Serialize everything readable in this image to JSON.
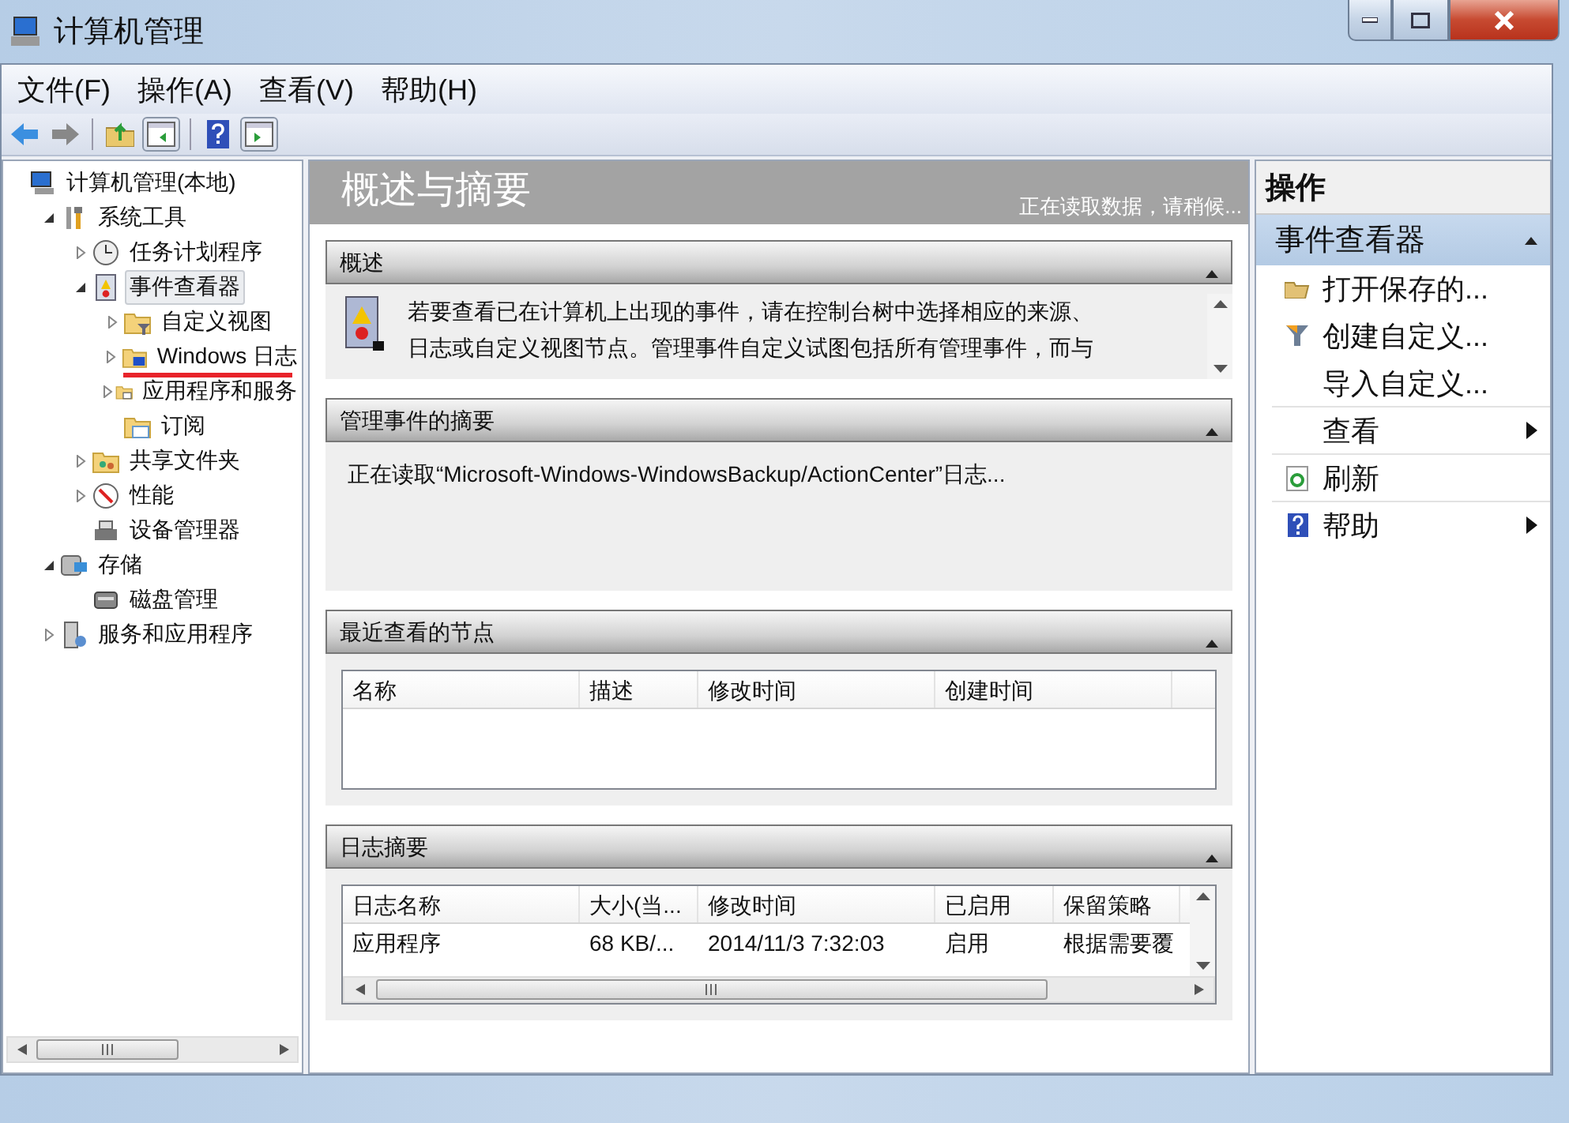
{
  "window": {
    "title": "计算机管理"
  },
  "menu": [
    {
      "label": "文件(F)"
    },
    {
      "label": "操作(A)"
    },
    {
      "label": "查看(V)"
    },
    {
      "label": "帮助(H)"
    }
  ],
  "tree": [
    {
      "label": "计算机管理(本地)",
      "kind": "computer",
      "selected": false,
      "underlined": false,
      "children": [
        {
          "label": "系统工具",
          "kind": "tools",
          "expanded": true,
          "selected": false,
          "underlined": false,
          "children": [
            {
              "label": "任务计划程序",
              "kind": "clock",
              "expanded": false,
              "selected": false,
              "underlined": false
            },
            {
              "label": "事件查看器",
              "kind": "log",
              "expanded": true,
              "selected": true,
              "underlined": false,
              "children": [
                {
                  "label": "自定义视图",
                  "kind": "filter-folder",
                  "expanded": false,
                  "selected": false,
                  "underlined": false
                },
                {
                  "label": "Windows 日志",
                  "kind": "monitor-folder",
                  "expanded": false,
                  "selected": false,
                  "underlined": true
                },
                {
                  "label": "应用程序和服务",
                  "kind": "window-folder",
                  "expanded": false,
                  "selected": false,
                  "underlined": false
                },
                {
                  "label": "订阅",
                  "kind": "calendar-folder",
                  "selected": false,
                  "underlined": false
                }
              ]
            },
            {
              "label": "共享文件夹",
              "kind": "share",
              "expanded": false,
              "selected": false,
              "underlined": false
            },
            {
              "label": "性能",
              "kind": "gauge",
              "expanded": false,
              "selected": false,
              "underlined": false
            },
            {
              "label": "设备管理器",
              "kind": "device",
              "selected": false,
              "underlined": false
            }
          ]
        },
        {
          "label": "存储",
          "kind": "storage",
          "expanded": true,
          "selected": false,
          "underlined": false,
          "children": [
            {
              "label": "磁盘管理",
              "kind": "disk",
              "selected": false,
              "underlined": false
            }
          ]
        },
        {
          "label": "服务和应用程序",
          "kind": "server",
          "expanded": false,
          "selected": false,
          "underlined": false
        }
      ]
    }
  ],
  "center": {
    "title": "概述与摘要",
    "status": "正在读取数据，请稍候...",
    "sections": [
      {
        "kind": "text",
        "title": "概述",
        "expanded": true,
        "lines": [
          "若要查看已在计算机上出现的事件，请在控制台树中选择相应的来源、",
          "日志或自定义视图节点。管理事件自定义试图包括所有管理事件，而与"
        ]
      },
      {
        "kind": "status",
        "title": "管理事件的摘要",
        "expanded": true,
        "text": "正在读取“Microsoft-Windows-WindowsBackup/ActionCenter”日志..."
      },
      {
        "kind": "table",
        "title": "最近查看的节点",
        "expanded": true,
        "columns": [
          "名称",
          "描述",
          "修改时间",
          "创建时间"
        ]
      },
      {
        "kind": "table",
        "title": "日志摘要",
        "expanded": true,
        "columns": [
          "日志名称",
          "大小(当...",
          "修改时间",
          "已启用",
          "保留策略"
        ],
        "rows": [
          [
            "应用程序",
            "68 KB/...",
            "2014/11/3 7:32:03",
            "启用",
            "根据需要覆"
          ]
        ]
      }
    ]
  },
  "actions": {
    "title": "操作",
    "group": "事件查看器",
    "group_expanded": true,
    "items": [
      {
        "label": "打开保存的...",
        "kind": "open",
        "submenu": false,
        "separated": false
      },
      {
        "label": "创建自定义...",
        "kind": "filter",
        "submenu": false,
        "separated": false
      },
      {
        "label": "导入自定义...",
        "kind": "none",
        "submenu": false,
        "separated": true
      },
      {
        "label": "查看",
        "kind": "none",
        "submenu": true,
        "separated": true
      },
      {
        "label": "刷新",
        "kind": "refresh",
        "submenu": false,
        "separated": true
      },
      {
        "label": "帮助",
        "kind": "help",
        "submenu": true,
        "separated": false
      }
    ]
  }
}
